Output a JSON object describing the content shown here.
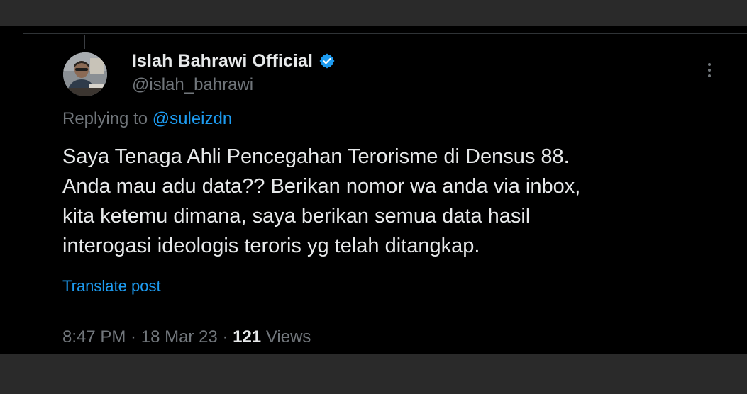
{
  "author": {
    "display_name": "Islah Bahrawi Official",
    "handle": "@islah_bahrawi",
    "verified": true,
    "avatar_icon": "profile-photo"
  },
  "reply": {
    "prefix": "Replying to ",
    "mention": "@suleizdn"
  },
  "tweet": {
    "lines": [
      "Saya Tenaga Ahli Pencegahan Terorisme di Densus 88.",
      "Anda mau adu data?? Berikan nomor wa anda via inbox,",
      "kita ketemu dimana, saya berikan semua data hasil",
      "interogasi ideologis teroris yg telah ditangkap."
    ],
    "translate_label": "Translate post"
  },
  "meta": {
    "time": "8:47 PM",
    "separator": " · ",
    "date": "18 Mar 23",
    "views_count": "121",
    "views_label": " Views"
  },
  "colors": {
    "background": "#000000",
    "text": "#e7e9ea",
    "muted": "#71767b",
    "accent": "#1d9bf0",
    "letterbox": "#2a2a2a"
  }
}
